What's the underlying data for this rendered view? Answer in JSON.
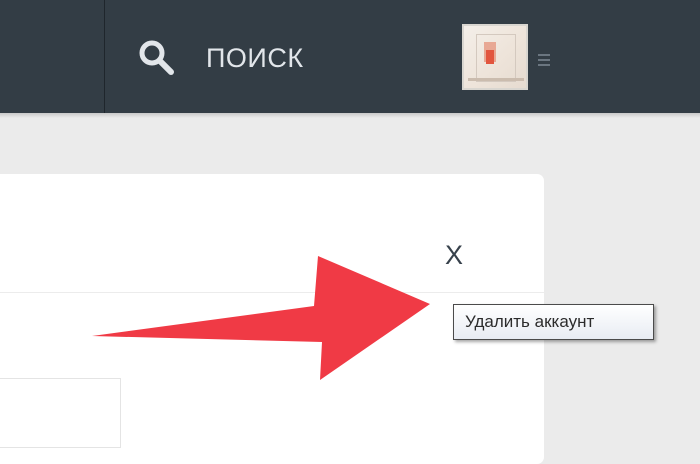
{
  "header": {
    "search_label": "ПОИСК",
    "search_icon": "search-icon",
    "background_color": "#333d45"
  },
  "avatar": {
    "icon": "avatar",
    "menu_icon": "menu-caret-icon"
  },
  "dialog": {
    "close_label": "X"
  },
  "tooltip": {
    "text": "Удалить аккаунт"
  },
  "annotation": {
    "type": "arrow",
    "color": "#f03a45"
  }
}
